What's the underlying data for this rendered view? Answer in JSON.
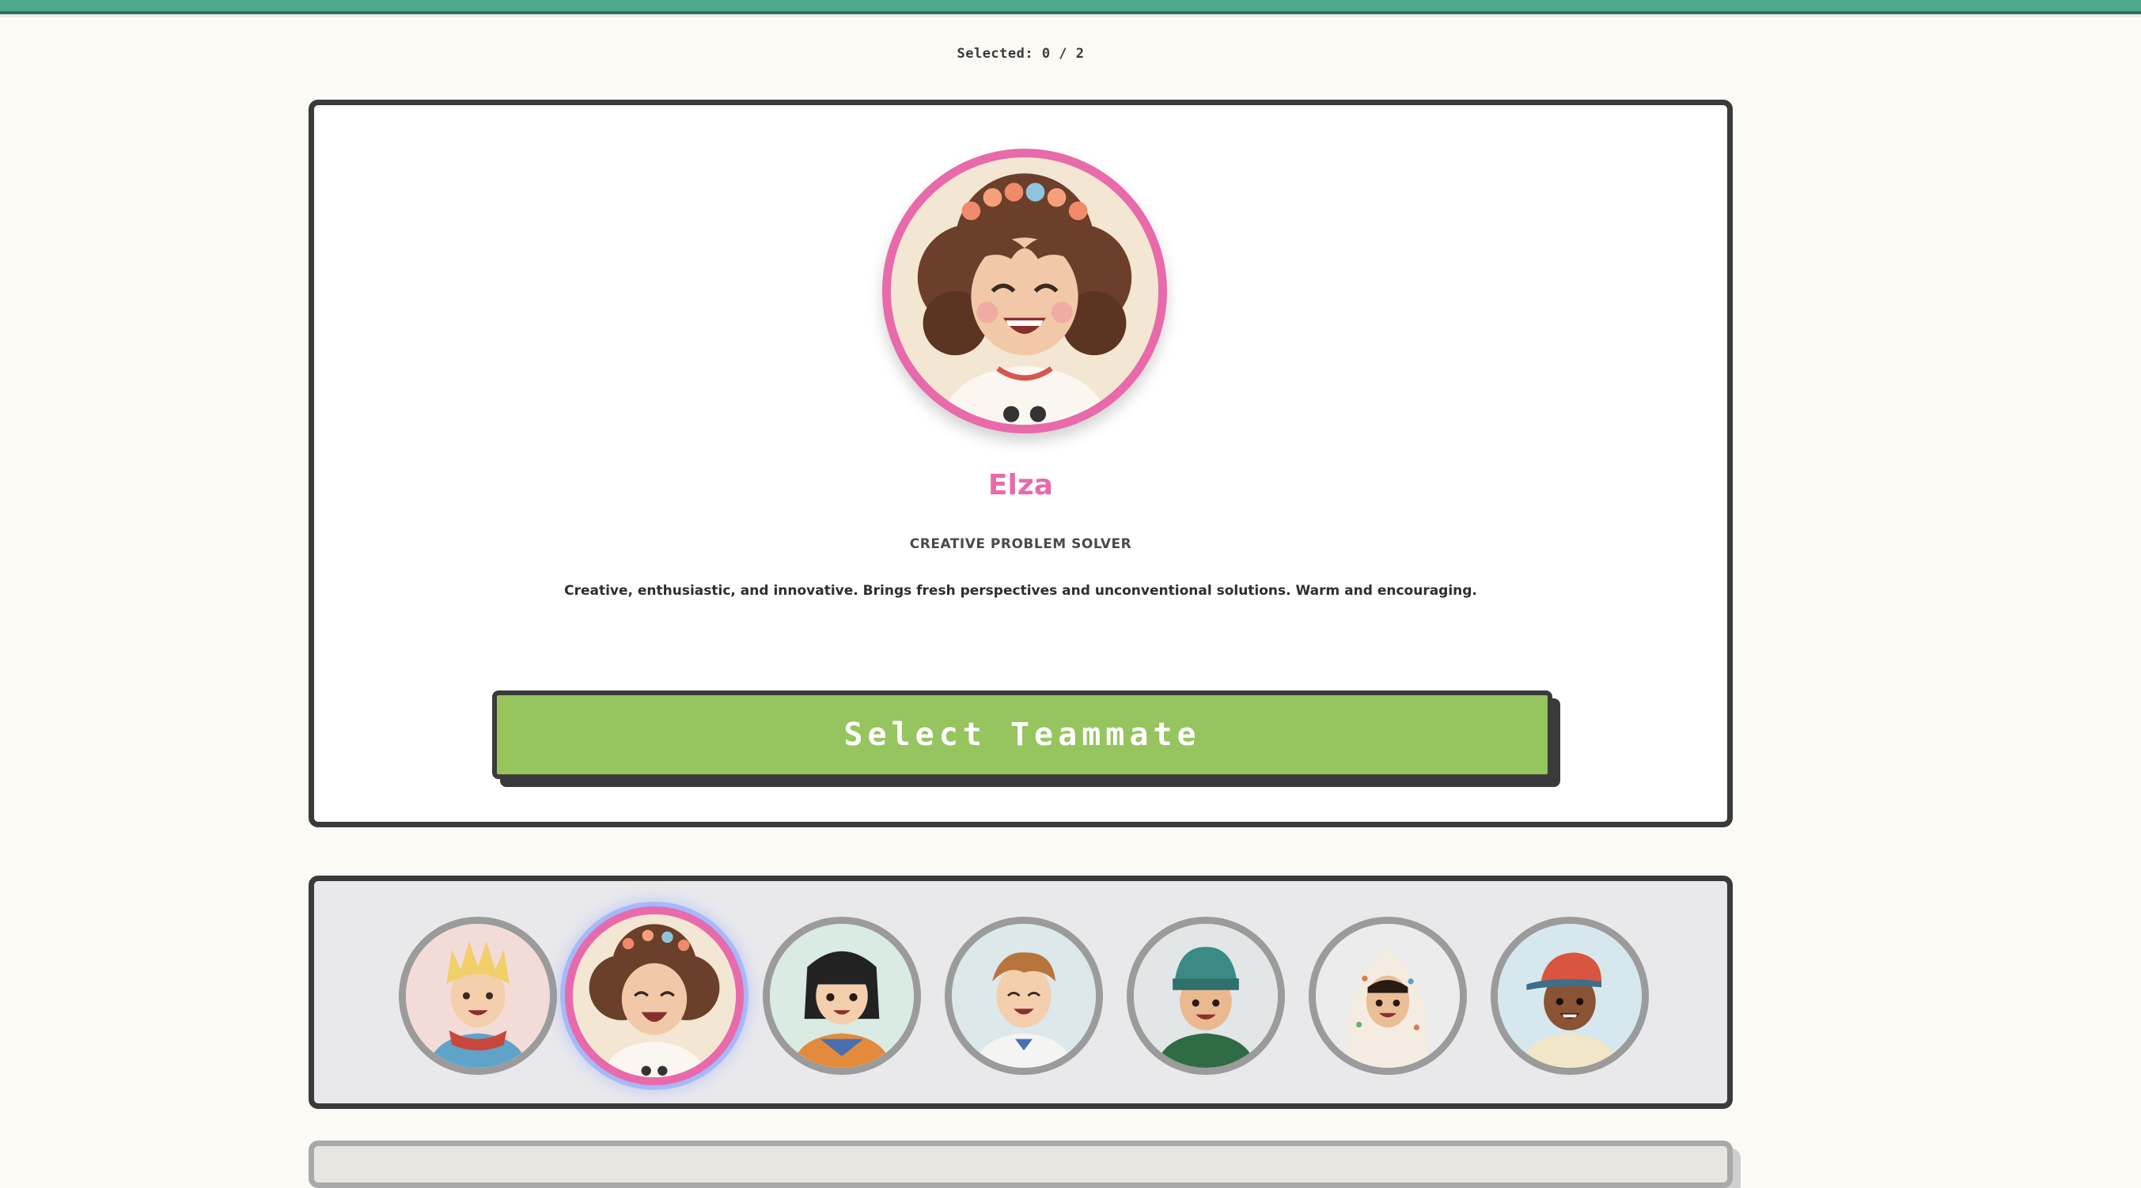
{
  "status": {
    "selected_text": "Selected: 0 / 2"
  },
  "profile": {
    "name": "Elza",
    "role": "CREATIVE PROBLEM SOLVER",
    "description": "Creative, enthusiastic, and innovative. Brings fresh perspectives and unconventional solutions. Warm and encouraging.",
    "avatar_icon": "girl-curly-hair-flower-crown-avatar"
  },
  "actions": {
    "select_label": "Select Teammate"
  },
  "roster": {
    "active_index": 1,
    "avatars": [
      {
        "icon": "blonde-spiky-boy-red-scarf-avatar"
      },
      {
        "icon": "girl-curly-hair-flower-crown-avatar"
      },
      {
        "icon": "girl-black-bob-hair-avatar"
      },
      {
        "icon": "boy-light-brown-hair-avatar"
      },
      {
        "icon": "boy-green-beanie-avatar"
      },
      {
        "icon": "girl-floral-hood-avatar"
      },
      {
        "icon": "boy-red-cap-avatar"
      }
    ]
  },
  "colors": {
    "accent_pink": "#e86aab",
    "button_green": "#96c45f",
    "top_bar_teal": "#4ea98f",
    "border_dark": "#3a3a3a",
    "background": "#fcfaf4"
  }
}
